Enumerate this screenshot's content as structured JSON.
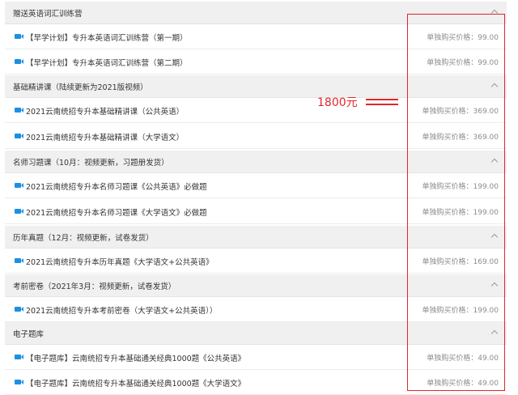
{
  "sections": [
    {
      "title": "赠送英语词汇训练营",
      "lessons": [
        {
          "title": "【早学计划】专升本英语词汇训练营（第一期）",
          "price": "单独购买价格：99.00"
        },
        {
          "title": "【早学计划】专升本英语词汇训练营（第二期）",
          "price": "单独购买价格：99.00"
        }
      ]
    },
    {
      "title": "基础精讲课（陆续更新为2021版视频）",
      "lessons": [
        {
          "title": "2021云南统招专升本基础精讲课（公共英语）",
          "price": "单独购买价格：369.00"
        },
        {
          "title": "2021云南统招专升本基础精讲课（大学语文）",
          "price": "单独购买价格：369.00"
        }
      ]
    },
    {
      "title": "名师习题课（10月：视频更新，习题册发货）",
      "lessons": [
        {
          "title": "2021云南统招专升本名师习题课《公共英语》必做题",
          "price": "单独购买价格：199.00"
        },
        {
          "title": "2021云南统招专升本名师习题课《大学语文》必做题",
          "price": "单独购买价格：199.00"
        }
      ]
    },
    {
      "title": "历年真题（12月：视频更新，试卷发货）",
      "lessons": [
        {
          "title": "2021云南统招专升本历年真题《大学语文+公共英语》",
          "price": "单独购买价格：169.00"
        }
      ]
    },
    {
      "title": "考前密卷（2021年3月：视频更新，试卷发货）",
      "lessons": [
        {
          "title": "2021云南统招专升本考前密卷（大学语文+公共英语））",
          "price": "单独购买价格：199.00"
        }
      ]
    },
    {
      "title": "电子题库",
      "lessons": [
        {
          "title": "【电子题库】云南统招专升本基础通关经典1000题《公共英语》",
          "price": "单独购买价格：49.00"
        },
        {
          "title": "【电子题库】云南统招专升本基础通关经典1000题《大学语文》",
          "price": "单独购买价格：49.00"
        }
      ]
    }
  ],
  "annotation": {
    "total_label": "1800元",
    "color": "#e0262b"
  },
  "colors": {
    "section_bg": "#f0f0f0",
    "video_icon": "#1e8fe1",
    "price_text": "#8c8c8c"
  },
  "icons": {
    "lesson": "video-camera-icon",
    "section_toggle": "chevron-up-icon"
  }
}
